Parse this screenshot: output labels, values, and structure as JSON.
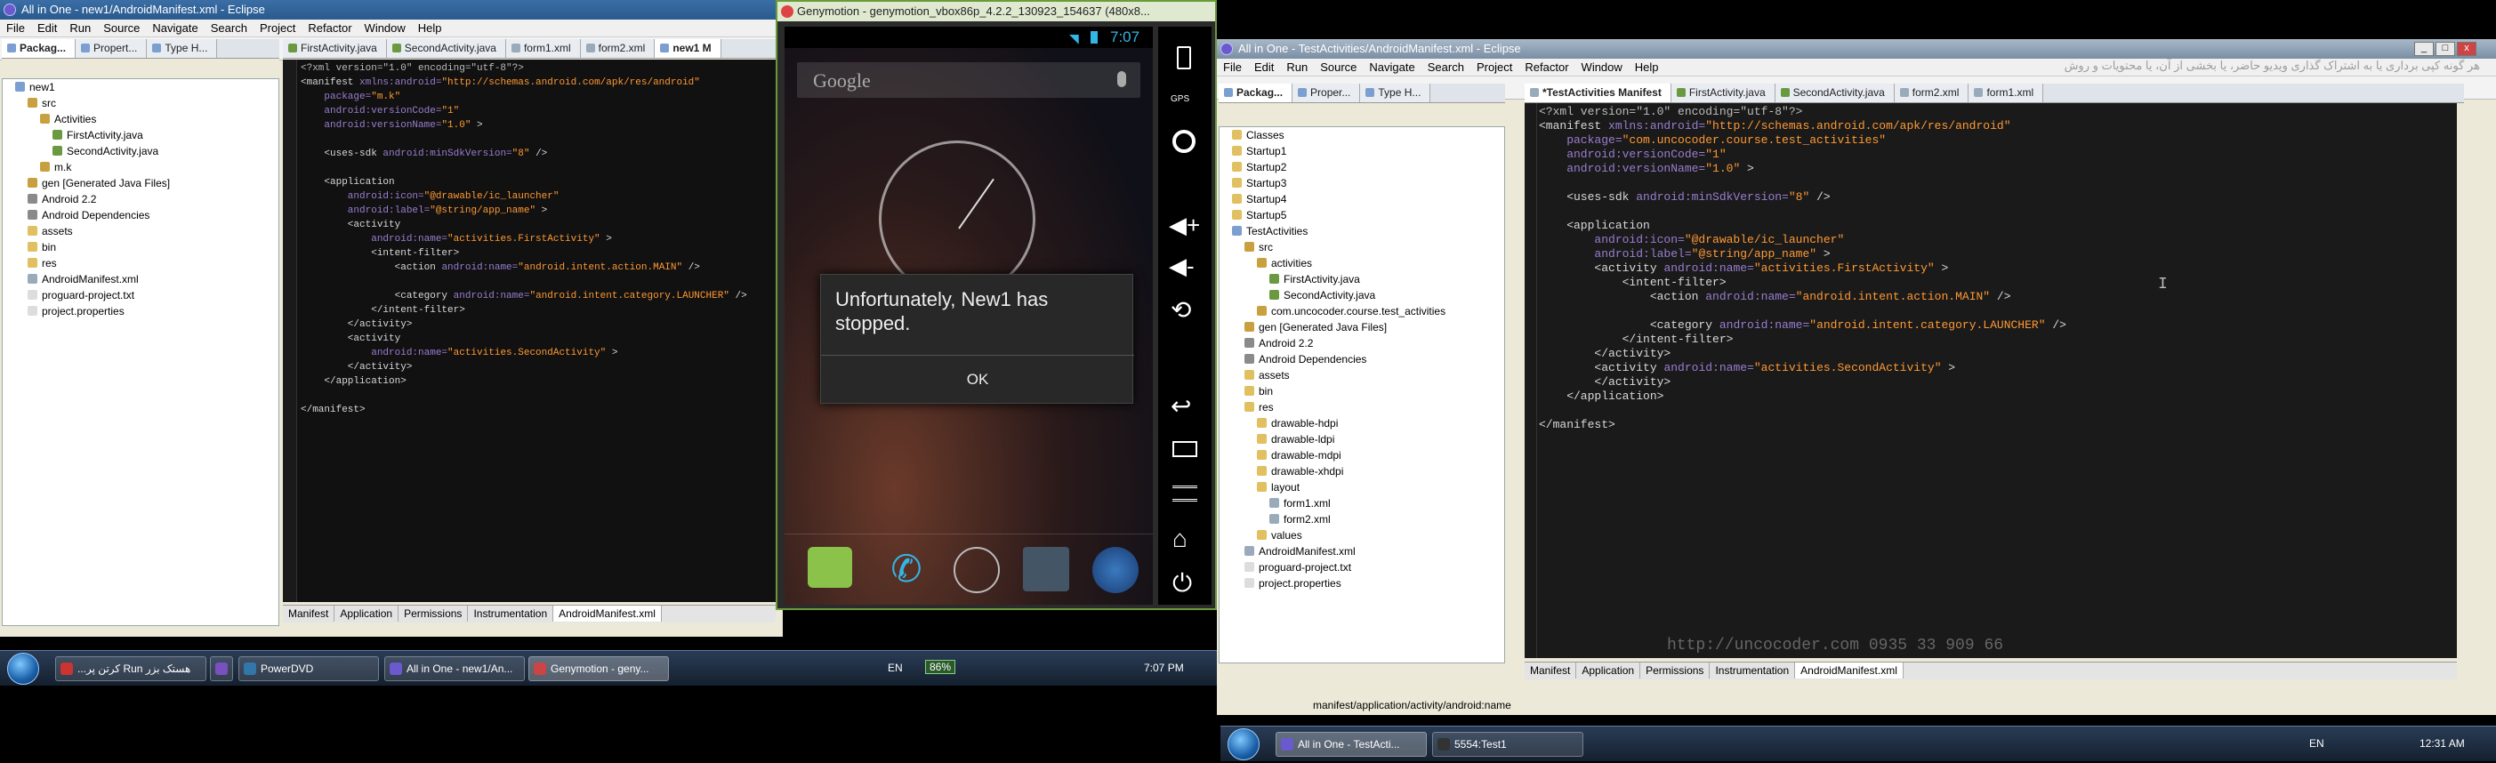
{
  "left_eclipse": {
    "title": "All in One - new1/AndroidManifest.xml - Eclipse",
    "menu": [
      "File",
      "Edit",
      "Run",
      "Source",
      "Navigate",
      "Search",
      "Project",
      "Refactor",
      "Window",
      "Help"
    ],
    "panel_tabs": [
      "Packag...",
      "Propert...",
      "Type H..."
    ],
    "editor_tabs": [
      "FirstActivity.java",
      "SecondActivity.java",
      "form1.xml",
      "form2.xml",
      "new1 M"
    ],
    "tree": [
      {
        "label": "new1",
        "indent": 1,
        "color": "#7a9fd0"
      },
      {
        "label": "src",
        "indent": 2,
        "color": "#c8a040"
      },
      {
        "label": "Activities",
        "indent": 3,
        "color": "#c8a040"
      },
      {
        "label": "FirstActivity.java",
        "indent": 4,
        "color": "#6a9a40"
      },
      {
        "label": "SecondActivity.java",
        "indent": 4,
        "color": "#6a9a40"
      },
      {
        "label": "m.k",
        "indent": 3,
        "color": "#c8a040"
      },
      {
        "label": "gen [Generated Java Files]",
        "indent": 2,
        "color": "#c8a040"
      },
      {
        "label": "Android 2.2",
        "indent": 2,
        "color": "#8a8a8a"
      },
      {
        "label": "Android Dependencies",
        "indent": 2,
        "color": "#8a8a8a"
      },
      {
        "label": "assets",
        "indent": 2,
        "color": "#e0c060"
      },
      {
        "label": "bin",
        "indent": 2,
        "color": "#e0c060"
      },
      {
        "label": "res",
        "indent": 2,
        "color": "#e0c060"
      },
      {
        "label": "AndroidManifest.xml",
        "indent": 2,
        "color": "#9ab"
      },
      {
        "label": "proguard-project.txt",
        "indent": 2,
        "color": "#ddd"
      },
      {
        "label": "project.properties",
        "indent": 2,
        "color": "#ddd"
      }
    ],
    "code": [
      [
        [
          "c-pi",
          "<?xml version=\"1.0\" encoding=\"utf-8\"?>"
        ]
      ],
      [
        [
          "c-tag",
          "<manifest "
        ],
        [
          "c-att",
          "xmlns:android="
        ],
        [
          "c-val",
          "\"http://schemas.android.com/apk/res/android\""
        ]
      ],
      [
        [
          "c-att",
          "    package="
        ],
        [
          "c-val",
          "\"m.k\""
        ]
      ],
      [
        [
          "c-att",
          "    android:versionCode="
        ],
        [
          "c-val",
          "\"1\""
        ]
      ],
      [
        [
          "c-att",
          "    android:versionName="
        ],
        [
          "c-val",
          "\"1.0\""
        ],
        [
          "c-tag",
          " >"
        ]
      ],
      [
        [
          "c-tag",
          ""
        ]
      ],
      [
        [
          "c-tag",
          "    <uses-sdk "
        ],
        [
          "c-att",
          "android:minSdkVersion="
        ],
        [
          "c-val",
          "\"8\""
        ],
        [
          "c-tag",
          " />"
        ]
      ],
      [
        [
          "c-tag",
          ""
        ]
      ],
      [
        [
          "c-tag",
          "    <application"
        ]
      ],
      [
        [
          "c-att",
          "        android:icon="
        ],
        [
          "c-val",
          "\"@drawable/ic_launcher\""
        ]
      ],
      [
        [
          "c-att",
          "        android:label="
        ],
        [
          "c-val",
          "\"@string/app_name\""
        ],
        [
          "c-tag",
          " >"
        ]
      ],
      [
        [
          "c-tag",
          "        <activity"
        ]
      ],
      [
        [
          "c-att",
          "            android:name="
        ],
        [
          "c-val",
          "\"activities.FirstActivity\""
        ],
        [
          "c-tag",
          " >"
        ]
      ],
      [
        [
          "c-tag",
          "            <intent-filter>"
        ]
      ],
      [
        [
          "c-tag",
          "                <action "
        ],
        [
          "c-att",
          "android:name="
        ],
        [
          "c-val",
          "\"android.intent.action.MAIN\""
        ],
        [
          "c-tag",
          " />"
        ]
      ],
      [
        [
          "c-tag",
          ""
        ]
      ],
      [
        [
          "c-tag",
          "                <category "
        ],
        [
          "c-att",
          "android:name="
        ],
        [
          "c-val",
          "\"android.intent.category.LAUNCHER\""
        ],
        [
          "c-tag",
          " />"
        ]
      ],
      [
        [
          "c-tag",
          "            </intent-filter>"
        ]
      ],
      [
        [
          "c-tag",
          "        </activity>"
        ]
      ],
      [
        [
          "c-tag",
          "        <activity"
        ]
      ],
      [
        [
          "c-att",
          "            android:name="
        ],
        [
          "c-val",
          "\"activities.SecondActivity\""
        ],
        [
          "c-tag",
          " >"
        ]
      ],
      [
        [
          "c-tag",
          "        </activity>"
        ]
      ],
      [
        [
          "c-tag",
          "    </application>"
        ]
      ],
      [
        [
          "c-tag",
          ""
        ]
      ],
      [
        [
          "c-tag",
          "</manifest>"
        ]
      ]
    ],
    "bottom_tabs": [
      "Manifest",
      "Application",
      "Permissions",
      "Instrumentation",
      "AndroidManifest.xml"
    ]
  },
  "genymotion": {
    "title": "Genymotion - genymotion_vbox86p_4.2.2_130923_154637 (480x8...",
    "clock": "7:07",
    "search_placeholder": "Google",
    "dialog_message": "Unfortunately, New1 has stopped.",
    "dialog_button": "OK",
    "gps_label": "GPS"
  },
  "left_taskbar": {
    "items": [
      "...کرتن پر Run هستک بزر",
      "",
      "PowerDVD",
      "All in One - new1/An...",
      "Genymotion - geny..."
    ],
    "lang": "EN",
    "battery": "86%",
    "time": "7:07 PM"
  },
  "right_eclipse": {
    "title": "All in One - TestActivities/AndroidManifest.xml - Eclipse",
    "menu": [
      "File",
      "Edit",
      "Run",
      "Source",
      "Navigate",
      "Search",
      "Project",
      "Refactor",
      "Window",
      "Help"
    ],
    "watermark_top": "هر گونه کپی برداری یا به اشتراک گذاری ویدیو حاضر، یا بخشی از آن، یا محتویات و روش",
    "panel_tabs": [
      "Packag...",
      "Proper...",
      "Type H..."
    ],
    "editor_tabs": [
      "*TestActivities Manifest",
      "FirstActivity.java",
      "SecondActivity.java",
      "form2.xml",
      "form1.xml"
    ],
    "tree": [
      {
        "label": "Classes",
        "indent": 1,
        "color": "#e0c060"
      },
      {
        "label": "Startup1",
        "indent": 1,
        "color": "#e0c060"
      },
      {
        "label": "Startup2",
        "indent": 1,
        "color": "#e0c060"
      },
      {
        "label": "Startup3",
        "indent": 1,
        "color": "#e0c060"
      },
      {
        "label": "Startup4",
        "indent": 1,
        "color": "#e0c060"
      },
      {
        "label": "Startup5",
        "indent": 1,
        "color": "#e0c060"
      },
      {
        "label": "TestActivities",
        "indent": 1,
        "color": "#7a9fd0"
      },
      {
        "label": "src",
        "indent": 2,
        "color": "#c8a040"
      },
      {
        "label": "activities",
        "indent": 3,
        "color": "#c8a040"
      },
      {
        "label": "FirstActivity.java",
        "indent": 4,
        "color": "#6a9a40"
      },
      {
        "label": "SecondActivity.java",
        "indent": 4,
        "color": "#6a9a40"
      },
      {
        "label": "com.uncocoder.course.test_activities",
        "indent": 3,
        "color": "#c8a040"
      },
      {
        "label": "gen [Generated Java Files]",
        "indent": 2,
        "color": "#c8a040"
      },
      {
        "label": "Android 2.2",
        "indent": 2,
        "color": "#8a8a8a"
      },
      {
        "label": "Android Dependencies",
        "indent": 2,
        "color": "#8a8a8a"
      },
      {
        "label": "assets",
        "indent": 2,
        "color": "#e0c060"
      },
      {
        "label": "bin",
        "indent": 2,
        "color": "#e0c060"
      },
      {
        "label": "res",
        "indent": 2,
        "color": "#e0c060"
      },
      {
        "label": "drawable-hdpi",
        "indent": 3,
        "color": "#e0c060"
      },
      {
        "label": "drawable-ldpi",
        "indent": 3,
        "color": "#e0c060"
      },
      {
        "label": "drawable-mdpi",
        "indent": 3,
        "color": "#e0c060"
      },
      {
        "label": "drawable-xhdpi",
        "indent": 3,
        "color": "#e0c060"
      },
      {
        "label": "layout",
        "indent": 3,
        "color": "#e0c060"
      },
      {
        "label": "form1.xml",
        "indent": 4,
        "color": "#9ab"
      },
      {
        "label": "form2.xml",
        "indent": 4,
        "color": "#9ab"
      },
      {
        "label": "values",
        "indent": 3,
        "color": "#e0c060"
      },
      {
        "label": "AndroidManifest.xml",
        "indent": 2,
        "color": "#9ab"
      },
      {
        "label": "proguard-project.txt",
        "indent": 2,
        "color": "#ddd"
      },
      {
        "label": "project.properties",
        "indent": 2,
        "color": "#ddd"
      }
    ],
    "code": [
      [
        [
          "c-pi",
          "<?xml version=\"1.0\" encoding=\"utf-8\"?>"
        ]
      ],
      [
        [
          "c-tag",
          "<manifest "
        ],
        [
          "c-att",
          "xmlns:android="
        ],
        [
          "c-val",
          "\"http://schemas.android.com/apk/res/android\""
        ]
      ],
      [
        [
          "c-att",
          "    package="
        ],
        [
          "c-val",
          "\"com.uncocoder.course.test_activities\""
        ]
      ],
      [
        [
          "c-att",
          "    android:versionCode="
        ],
        [
          "c-val",
          "\"1\""
        ]
      ],
      [
        [
          "c-att",
          "    android:versionName="
        ],
        [
          "c-val",
          "\"1.0\""
        ],
        [
          "c-tag",
          " >"
        ]
      ],
      [
        [
          "c-tag",
          ""
        ]
      ],
      [
        [
          "c-tag",
          "    <uses-sdk "
        ],
        [
          "c-att",
          "android:minSdkVersion="
        ],
        [
          "c-val",
          "\"8\""
        ],
        [
          "c-tag",
          " />"
        ]
      ],
      [
        [
          "c-tag",
          ""
        ]
      ],
      [
        [
          "c-tag",
          "    <application"
        ]
      ],
      [
        [
          "c-att",
          "        android:icon="
        ],
        [
          "c-val",
          "\"@drawable/ic_launcher\""
        ]
      ],
      [
        [
          "c-att",
          "        android:label="
        ],
        [
          "c-val",
          "\"@string/app_name\""
        ],
        [
          "c-tag",
          " >"
        ]
      ],
      [
        [
          "c-tag",
          "        <activity "
        ],
        [
          "c-att",
          "android:name="
        ],
        [
          "c-val",
          "\"activities.FirstActivity\""
        ],
        [
          "c-tag",
          " >"
        ]
      ],
      [
        [
          "c-tag",
          "            <intent-filter>"
        ]
      ],
      [
        [
          "c-tag",
          "                <action "
        ],
        [
          "c-att",
          "android:name="
        ],
        [
          "c-val",
          "\"android.intent.action.MAIN\""
        ],
        [
          "c-tag",
          " />"
        ]
      ],
      [
        [
          "c-tag",
          ""
        ]
      ],
      [
        [
          "c-tag",
          "                <category "
        ],
        [
          "c-att",
          "android:name="
        ],
        [
          "c-val",
          "\"android.intent.category.LAUNCHER\""
        ],
        [
          "c-tag",
          " />"
        ]
      ],
      [
        [
          "c-tag",
          "            </intent-filter>"
        ]
      ],
      [
        [
          "c-tag",
          "        </activity>"
        ]
      ],
      [
        [
          "c-tag",
          "        <activity "
        ],
        [
          "c-att",
          "android:name="
        ],
        [
          "c-val",
          "\"activities.SecondActivity\""
        ],
        [
          "c-tag",
          " >"
        ]
      ],
      [
        [
          "c-tag",
          "        </activity>"
        ]
      ],
      [
        [
          "c-tag",
          "    </application>"
        ]
      ],
      [
        [
          "c-tag",
          ""
        ]
      ],
      [
        [
          "c-tag",
          "</manifest>"
        ]
      ]
    ],
    "watermark_bottom": "http://uncocoder.com   0935 33 909 66",
    "bottom_tabs": [
      "Manifest",
      "Application",
      "Permissions",
      "Instrumentation",
      "AndroidManifest.xml"
    ],
    "status": "manifest/application/activity/android:name"
  },
  "right_taskbar": {
    "items": [
      "All in One - TestActi...",
      "5554:Test1"
    ],
    "lang": "EN",
    "time": "12:31 AM"
  }
}
